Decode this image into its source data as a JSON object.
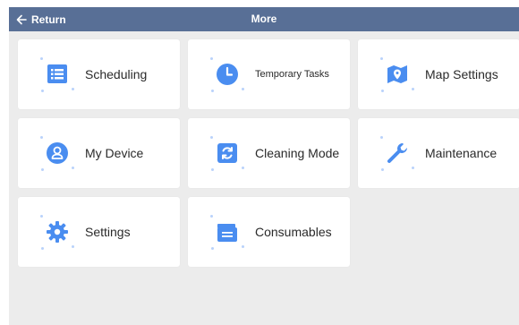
{
  "header": {
    "back_label": "Return",
    "title": "More"
  },
  "colors": {
    "header_bg": "#586f96",
    "icon_blue": "#4a8df0",
    "background": "#ececec"
  },
  "menu": {
    "items": [
      {
        "label": "Scheduling",
        "icon": "calendar-list-icon"
      },
      {
        "label": "Temporary Tasks",
        "icon": "clock-icon"
      },
      {
        "label": "Map Settings",
        "icon": "map-pin-icon"
      },
      {
        "label": "My Device",
        "icon": "user-circle-icon"
      },
      {
        "label": "Cleaning Mode",
        "icon": "refresh-icon"
      },
      {
        "label": "Maintenance",
        "icon": "wrench-icon"
      },
      {
        "label": "Settings",
        "icon": "gear-icon"
      },
      {
        "label": "Consumables",
        "icon": "box-icon"
      }
    ]
  }
}
